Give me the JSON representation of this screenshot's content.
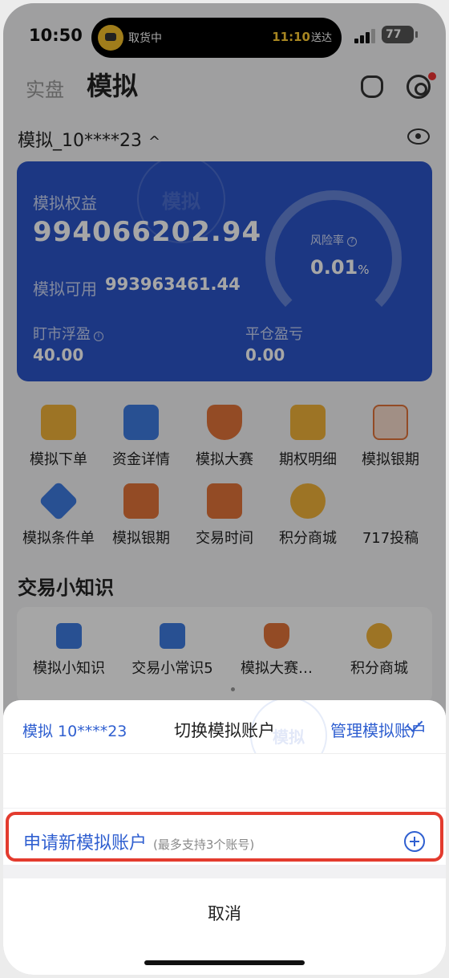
{
  "status_bar": {
    "time": "10:50",
    "activity_label": "取货中",
    "eta_time": "11:10",
    "eta_suffix": "送达",
    "battery": "77"
  },
  "header": {
    "tab_real": "实盘",
    "tab_sim": "模拟"
  },
  "account": {
    "name": "模拟_10****23",
    "chevron": "^"
  },
  "card": {
    "equity_label": "模拟权益",
    "equity_value": "994066202.94",
    "available_label": "模拟可用",
    "available_value": "993963461.44",
    "risk_label": "风险率",
    "risk_value": "0.01",
    "risk_unit": "%",
    "floating_label": "盯市浮盈",
    "floating_value": "40.00",
    "close_pl_label": "平仓盈亏",
    "close_pl_value": "0.00",
    "watermark": "模拟"
  },
  "quick_grid": [
    {
      "label": "模拟下单"
    },
    {
      "label": "资金详情"
    },
    {
      "label": "模拟大赛"
    },
    {
      "label": "期权明细"
    },
    {
      "label": "模拟银期"
    },
    {
      "label": "模拟条件单"
    },
    {
      "label": "模拟银期"
    },
    {
      "label": "交易时间"
    },
    {
      "label": "积分商城"
    },
    {
      "label": "717投稿"
    }
  ],
  "knowledge": {
    "title": "交易小知识",
    "items": [
      {
        "label": "模拟小知识"
      },
      {
        "label": "交易小常识5"
      },
      {
        "label": "模拟大赛…"
      },
      {
        "label": "积分商城"
      }
    ]
  },
  "sheet": {
    "title": "切换模拟账户",
    "manage": "管理模拟账户",
    "current_account": "模拟 10****23",
    "apply_label": "申请新模拟账户",
    "apply_note": "(最多支持3个账号)",
    "cancel": "取消"
  },
  "colors": {
    "accent": "#2f5fd0",
    "card_bg": "#2b55c9",
    "highlight": "#e33b2e"
  }
}
